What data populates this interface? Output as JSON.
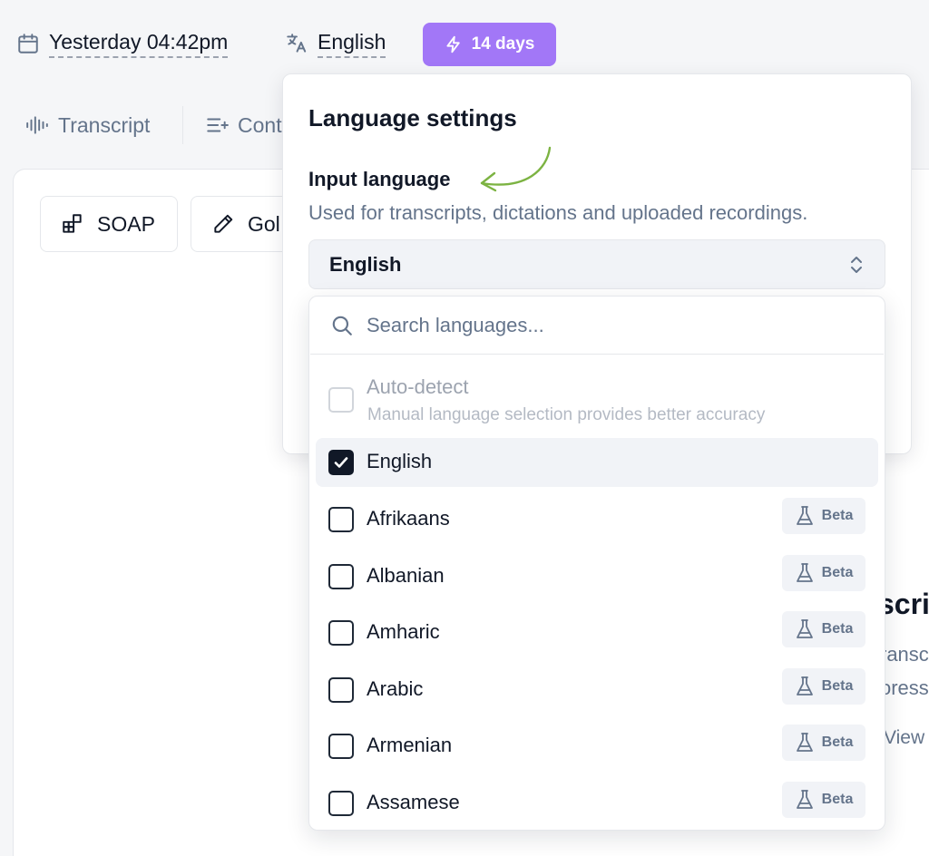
{
  "header": {
    "date": "Yesterday 04:42pm",
    "language": "English",
    "trial_badge": "14 days"
  },
  "tabs": [
    {
      "label": "Transcript",
      "icon": "waveform-icon"
    },
    {
      "label": "Cont",
      "icon": "context-icon"
    }
  ],
  "toolbar": {
    "soap_label": "SOAP",
    "gold_label": "Gol"
  },
  "background_panel": {
    "title_fragment": "scri",
    "line1_fragment": "ransc",
    "line2_fragment": "oress",
    "link_fragment": "View"
  },
  "language_settings": {
    "title": "Language settings",
    "input_label": "Input language",
    "input_description": "Used for transcripts, dictations and uploaded recordings.",
    "selected_value": "English",
    "search_placeholder": "Search languages...",
    "auto_detect": {
      "label": "Auto-detect",
      "sublabel": "Manual language selection provides better accuracy",
      "checked": false,
      "disabled": true
    },
    "options": [
      {
        "label": "English",
        "checked": true,
        "beta": false
      },
      {
        "label": "Afrikaans",
        "checked": false,
        "beta": true
      },
      {
        "label": "Albanian",
        "checked": false,
        "beta": true
      },
      {
        "label": "Amharic",
        "checked": false,
        "beta": true
      },
      {
        "label": "Arabic",
        "checked": false,
        "beta": true
      },
      {
        "label": "Armenian",
        "checked": false,
        "beta": true
      },
      {
        "label": "Assamese",
        "checked": false,
        "beta": true
      }
    ],
    "beta_label": "Beta"
  },
  "colors": {
    "accent": "#a277f7",
    "annotation_arrow": "#7cb342",
    "muted_text": "#64748b"
  }
}
